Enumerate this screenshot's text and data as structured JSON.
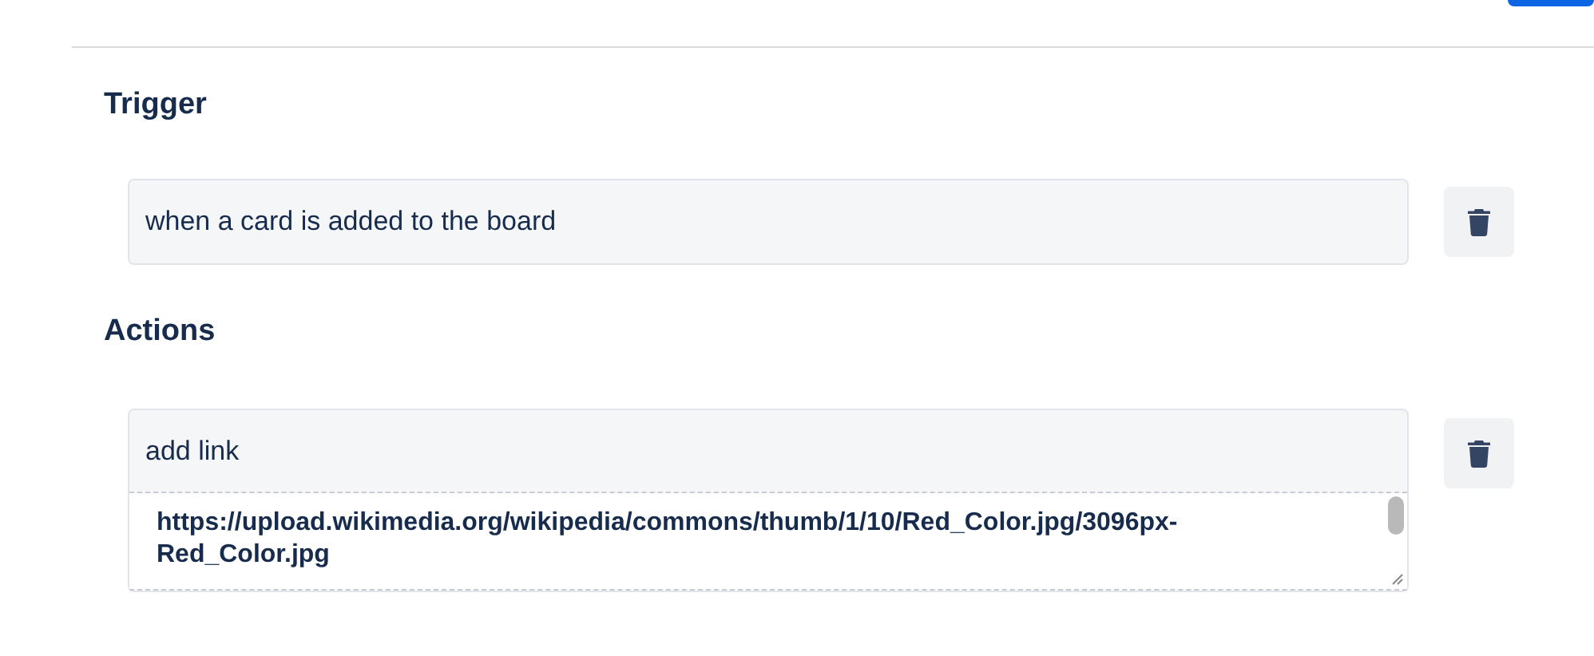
{
  "trigger": {
    "heading": "Trigger",
    "value": "when a card is added to the board"
  },
  "actions": {
    "heading": "Actions",
    "items": [
      {
        "title": "add link",
        "value": "https://upload.wikimedia.org/wikipedia/commons/thumb/1/10/Red_Color.jpg/3096px-Red_Color.jpg"
      }
    ]
  }
}
